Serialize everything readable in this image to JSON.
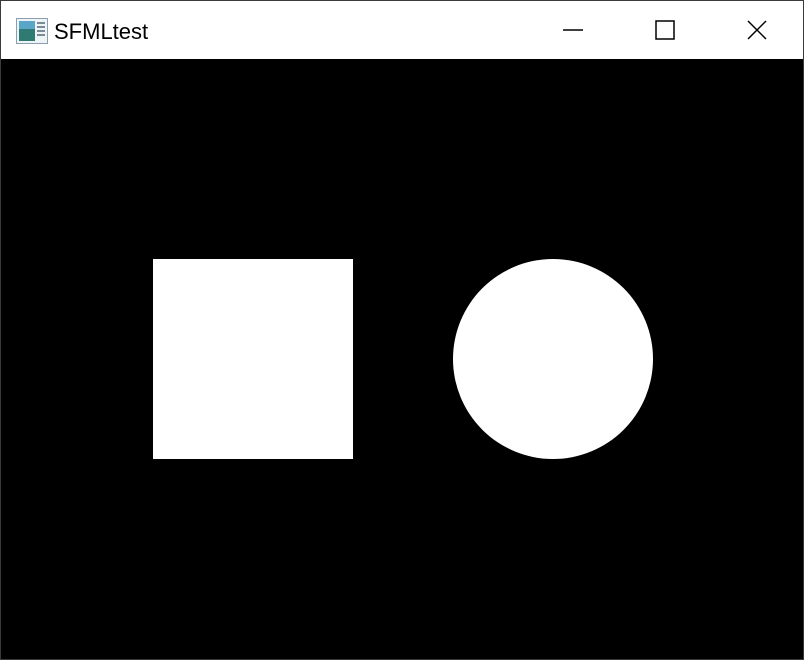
{
  "window": {
    "title": "SFMLtest",
    "icon": "sfml-app-icon",
    "controls": {
      "minimize_icon": "minimize-icon",
      "maximize_icon": "maximize-icon",
      "close_icon": "close-icon"
    }
  },
  "canvas": {
    "background_color": "#000000",
    "shapes": [
      {
        "type": "square",
        "color": "#ffffff"
      },
      {
        "type": "circle",
        "color": "#ffffff"
      }
    ]
  },
  "colors": {
    "titlebar": "#ffffff",
    "title_text": "#000000"
  }
}
